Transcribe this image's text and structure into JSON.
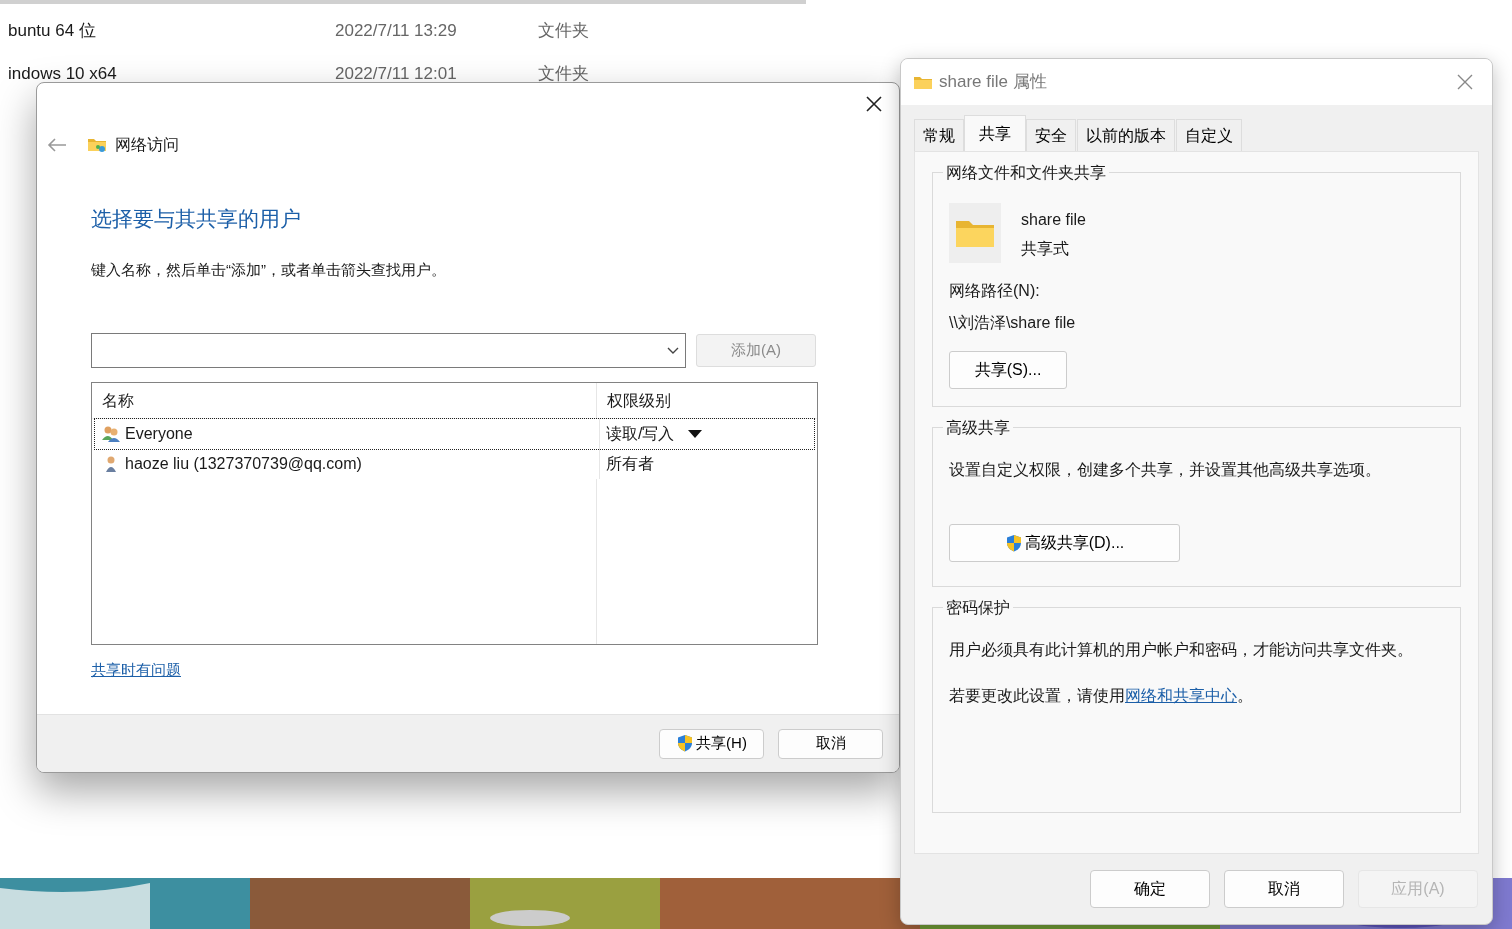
{
  "explorer": {
    "rows": [
      {
        "name": "buntu 64 位",
        "date": "2022/7/11 13:29",
        "type": "文件夹"
      },
      {
        "name": "indows 10 x64",
        "date": "2022/7/11 12:01",
        "type": "文件夹"
      }
    ]
  },
  "share_dialog": {
    "breadcrumb": "网络访问",
    "heading": "选择要与其共享的用户",
    "instruction": "键入名称，然后单击“添加”，或者单击箭头查找用户。",
    "add_button": {
      "label": "添加(A)",
      "disabled": true
    },
    "columns": [
      "名称",
      "权限级别"
    ],
    "users": [
      {
        "name": "Everyone",
        "permission": "读取/写入",
        "kind": "group",
        "selected": true
      },
      {
        "name": "haoze liu (1327370739@qq.com)",
        "permission": "所有者",
        "kind": "user",
        "selected": false
      }
    ],
    "help_link": "共享时有问题",
    "buttons": [
      {
        "label": "共享(H)",
        "shield": true
      },
      {
        "label": "取消",
        "shield": false
      }
    ]
  },
  "properties": {
    "title": "share file 属性",
    "tabs": [
      {
        "label": "常规",
        "selected": false
      },
      {
        "label": "共享",
        "selected": true
      },
      {
        "label": "安全",
        "selected": false
      },
      {
        "label": "以前的版本",
        "selected": false
      },
      {
        "label": "自定义",
        "selected": false
      }
    ],
    "network_sharing": {
      "title": "网络文件和文件夹共享",
      "name": "share file",
      "status": "共享式",
      "path_label": "网络路径(N):",
      "path": "\\\\刘浩泽\\share file",
      "button": "共享(S)..."
    },
    "advanced_sharing": {
      "title": "高级共享",
      "description": "设置自定义权限，创建多个共享，并设置其他高级共享选项。",
      "button": "高级共享(D)..."
    },
    "password": {
      "title": "密码保护",
      "description": "用户必须具有此计算机的用户帐户和密码，才能访问共享文件夹。",
      "note_before": "若要更改此设置，请使用",
      "note_link": "网络和共享中心",
      "note_after": "。"
    },
    "buttons": [
      {
        "label": "确定",
        "disabled": false
      },
      {
        "label": "取消",
        "disabled": false
      },
      {
        "label": "应用(A)",
        "disabled": true
      }
    ]
  }
}
